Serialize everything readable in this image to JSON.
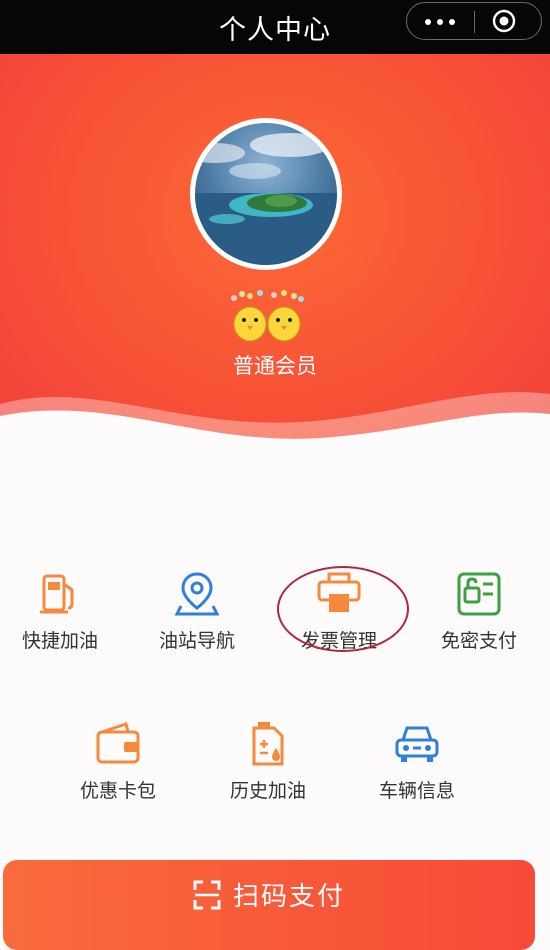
{
  "header": {
    "title": "个人中心"
  },
  "profile": {
    "member_level": "普通会员"
  },
  "menu": [
    {
      "label": "快捷加油",
      "icon": "fuel-pump-icon"
    },
    {
      "label": "油站导航",
      "icon": "location-pin-icon"
    },
    {
      "label": "发票管理",
      "icon": "printer-icon"
    },
    {
      "label": "免密支付",
      "icon": "lock-card-icon"
    },
    {
      "label": "优惠卡包",
      "icon": "wallet-icon"
    },
    {
      "label": "历史加油",
      "icon": "fuel-can-icon"
    },
    {
      "label": "车辆信息",
      "icon": "car-icon"
    }
  ],
  "scan": {
    "label": "扫码支付",
    "icon": "scan-icon"
  },
  "colors": {
    "accent": "#f85236",
    "icon_orange": "#f58a3c",
    "icon_blue": "#2f80d8",
    "icon_green": "#3aa040",
    "text": "#333333"
  }
}
